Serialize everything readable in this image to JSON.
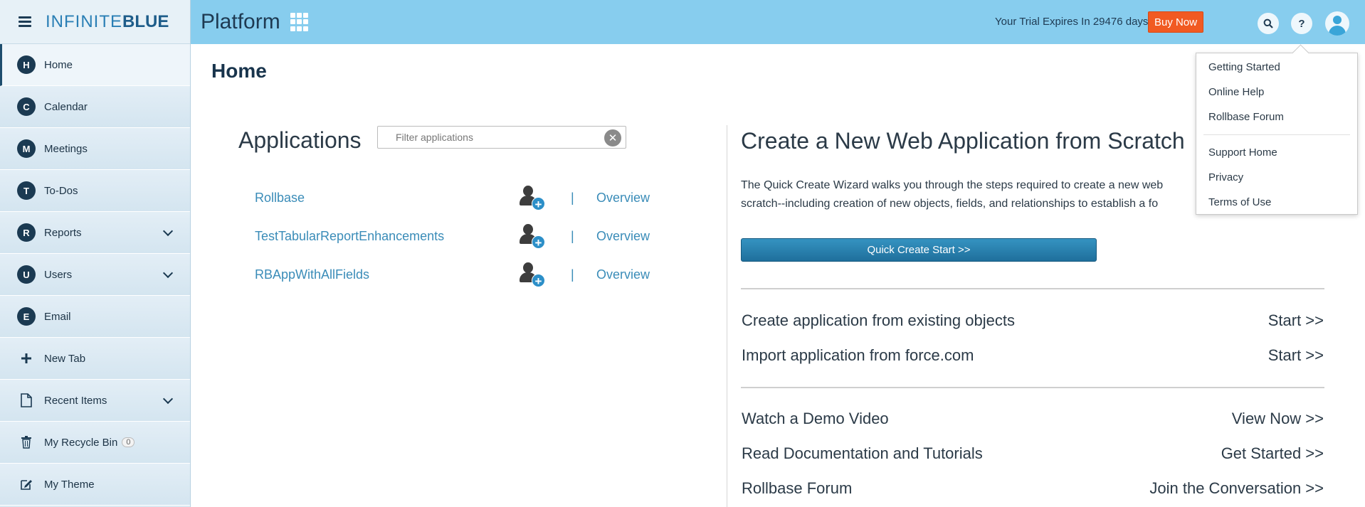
{
  "sidebar": {
    "logo_prefix": "INFINITE",
    "logo_suffix": "BLUE",
    "items": [
      {
        "badge": "H",
        "label": "Home"
      },
      {
        "badge": "C",
        "label": "Calendar"
      },
      {
        "badge": "M",
        "label": "Meetings"
      },
      {
        "badge": "T",
        "label": "To-Dos"
      },
      {
        "badge": "R",
        "label": "Reports"
      },
      {
        "badge": "U",
        "label": "Users"
      },
      {
        "badge": "E",
        "label": "Email"
      }
    ],
    "new_tab": "New Tab",
    "recent_items": "Recent Items",
    "recycle_bin": "My Recycle Bin",
    "recycle_count": "0",
    "my_theme": "My Theme"
  },
  "header": {
    "title": "Platform",
    "trial_text": "Your Trial Expires In 29476 days",
    "buy_now": "Buy Now",
    "help_glyph": "?"
  },
  "help_menu": {
    "items": [
      "Getting Started",
      "Online Help",
      "Rollbase Forum",
      "Support Home",
      "Privacy",
      "Terms of Use"
    ]
  },
  "main": {
    "page_title": "Home",
    "applications_title": "Applications",
    "filter_placeholder": "Filter applications",
    "apps": [
      {
        "name": "Rollbase",
        "link": "Overview"
      },
      {
        "name": "TestTabularReportEnhancements",
        "link": "Overview"
      },
      {
        "name": "RBAppWithAllFields",
        "link": "Overview"
      }
    ],
    "pipe": "|",
    "create_title": "Create a New Web Application from Scratch",
    "create_desc_line1": "The Quick Create Wizard walks you through the steps required to create a new web",
    "create_desc_line2": "scratch--including creation of new objects, fields, and relationships to establish a fo",
    "quick_create": "Quick Create Start >>",
    "links": [
      {
        "label": "Create application from existing objects",
        "action": "Start >>"
      },
      {
        "label": "Import application from force.com",
        "action": "Start >>"
      },
      {
        "label": "Watch a Demo Video",
        "action": "View Now >>"
      },
      {
        "label": "Read Documentation and Tutorials",
        "action": "Get Started >>"
      },
      {
        "label": "Rollbase Forum",
        "action": "Join the Conversation >>"
      }
    ]
  },
  "colors": {
    "topbar": "#87cdee",
    "sidebar": "#dbeaf3",
    "buy_now": "#f15a22",
    "link": "#3a8cb8",
    "quick_button": "#2a83b2"
  }
}
